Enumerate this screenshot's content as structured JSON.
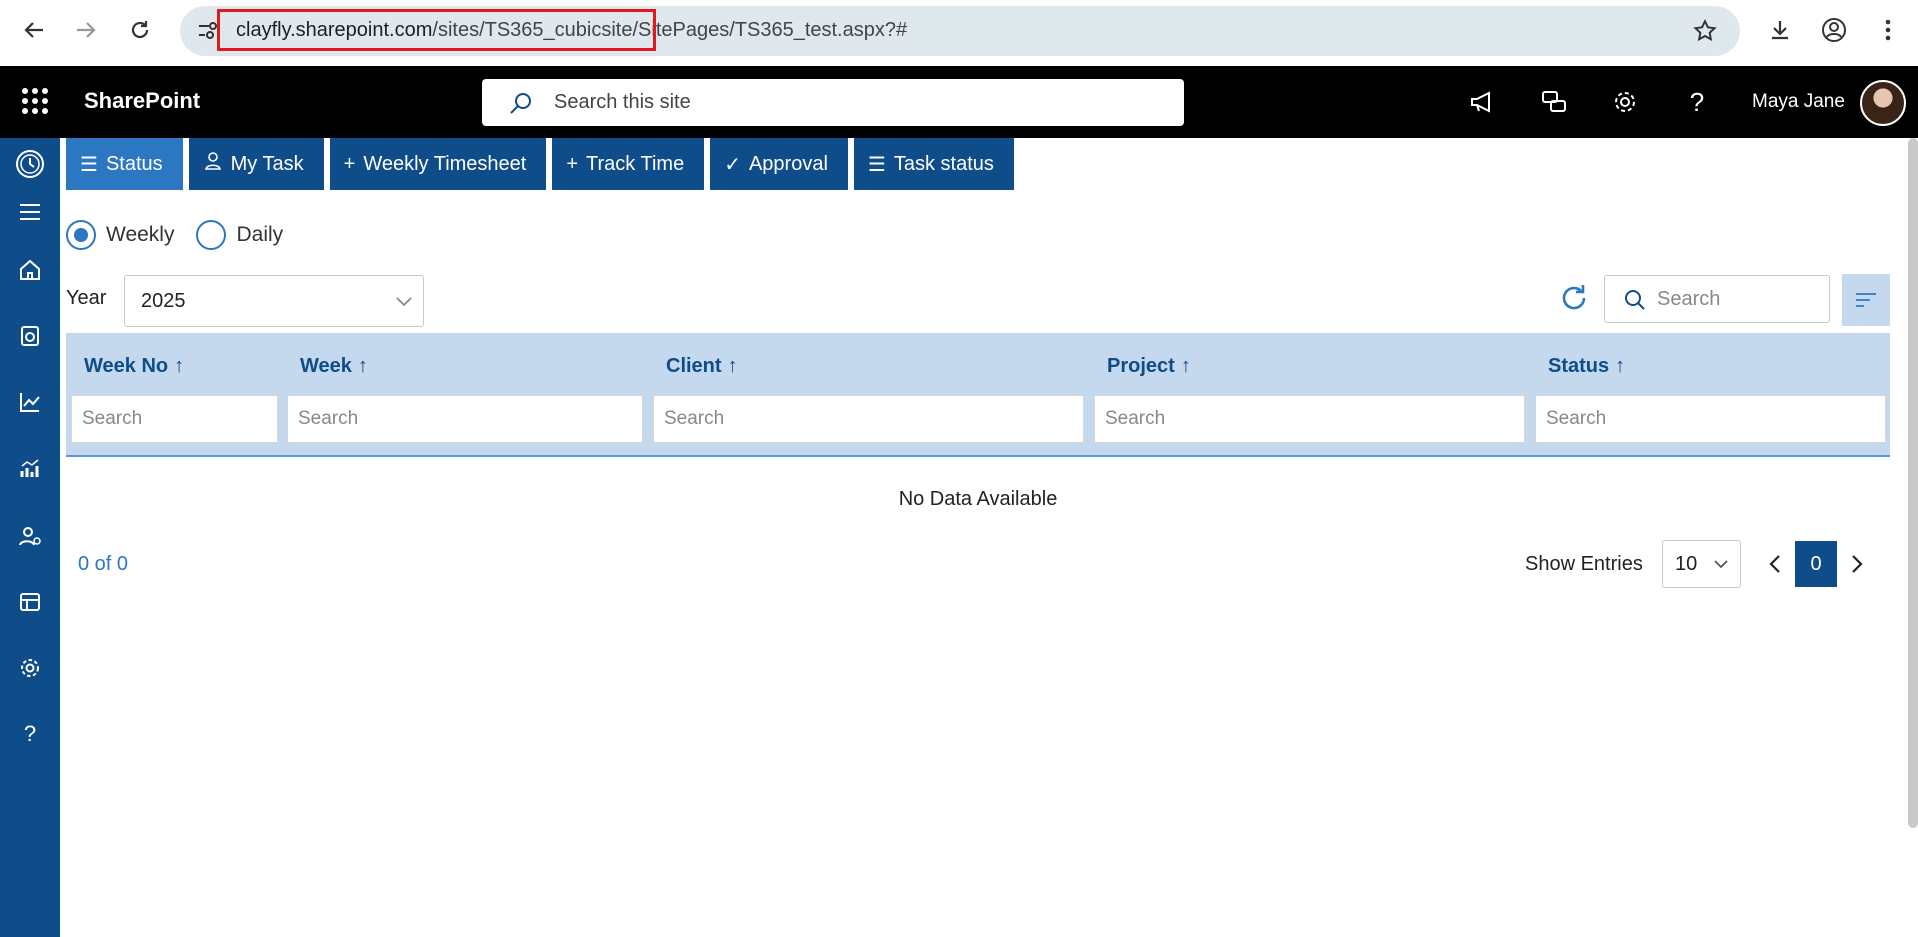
{
  "browser": {
    "url_host": "clayfly.sharepoint.com",
    "url_path": "/sites/TS365_cubicsite/SitePages/TS365_test.aspx?#"
  },
  "suite": {
    "app_name": "SharePoint",
    "search_placeholder": "Search this site",
    "user_name": "Maya Jane"
  },
  "tabs": [
    {
      "label": "Status",
      "icon": "list-check-icon",
      "active": true
    },
    {
      "label": "My Task",
      "icon": "person-icon"
    },
    {
      "label": "Weekly Timesheet",
      "icon": "plus-icon"
    },
    {
      "label": "Track Time",
      "icon": "plus-icon"
    },
    {
      "label": "Approval",
      "icon": "check-icon"
    },
    {
      "label": "Task status",
      "icon": "list-check-icon"
    }
  ],
  "view_mode": {
    "options": [
      {
        "label": "Weekly",
        "checked": true
      },
      {
        "label": "Daily",
        "checked": false
      }
    ]
  },
  "filters": {
    "year_label": "Year",
    "year_value": "2025",
    "search_placeholder": "Search"
  },
  "table": {
    "columns": [
      {
        "label": "Week No",
        "sort": "↑",
        "search": "Search"
      },
      {
        "label": "Week",
        "sort": "↑",
        "search": "Search"
      },
      {
        "label": "Client",
        "sort": "↑",
        "search": "Search"
      },
      {
        "label": "Project",
        "sort": "↑",
        "search": "Search"
      },
      {
        "label": "Status",
        "sort": "↑",
        "search": "Search"
      }
    ],
    "empty_text": "No Data Available"
  },
  "pager": {
    "count_text": "0 of 0",
    "show_entries_label": "Show Entries",
    "entries_value": "10",
    "current_page": "0"
  },
  "colors": {
    "brand_dark": "#0f4c8a",
    "brand_active": "#2c77c2",
    "header_bg": "#c5d9ee",
    "highlight": "#e0191e"
  }
}
